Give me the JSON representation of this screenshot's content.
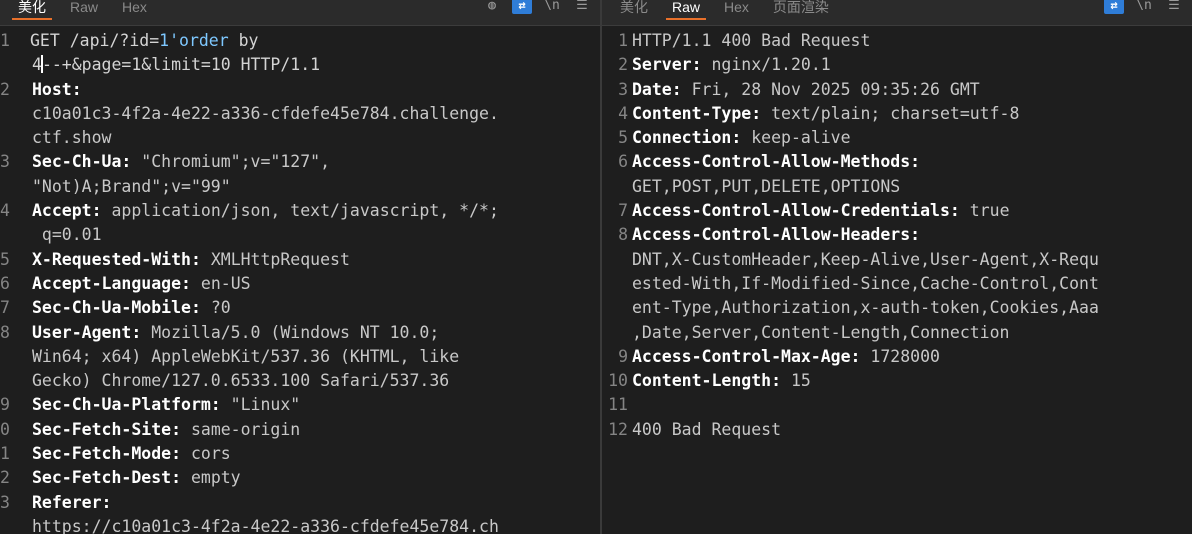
{
  "request": {
    "tabs": [
      {
        "label": "美化",
        "active": true
      },
      {
        "label": "Raw",
        "active": false
      },
      {
        "label": "Hex",
        "active": false
      }
    ],
    "lines": [
      {
        "num": "1",
        "a": "GET /api/?id=",
        "b": "1'order",
        "c": " by"
      },
      {
        "num": "",
        "a": "4",
        "b": "--+&page=1&limit=10 HTTP/1.1"
      },
      {
        "num": "2",
        "k": "Host:",
        "v": ""
      },
      {
        "num": "",
        "v": "c10a01c3-4f2a-4e22-a336-cfdefe45e784.challenge."
      },
      {
        "num": "",
        "v": "ctf.show"
      },
      {
        "num": "3",
        "k": "Sec-Ch-Ua:",
        "v": " \"Chromium\";v=\"127\","
      },
      {
        "num": "",
        "v": "\"Not)A;Brand\";v=\"99\""
      },
      {
        "num": "4",
        "k": "Accept:",
        "v": " application/json, text/javascript, */*;"
      },
      {
        "num": "",
        "v": " q=0.01"
      },
      {
        "num": "5",
        "k": "X-Requested-With:",
        "v": " XMLHttpRequest"
      },
      {
        "num": "6",
        "k": "Accept-Language:",
        "v": " en-US"
      },
      {
        "num": "7",
        "k": "Sec-Ch-Ua-Mobile:",
        "v": " ?0"
      },
      {
        "num": "8",
        "k": "User-Agent:",
        "v": " Mozilla/5.0 (Windows NT 10.0;"
      },
      {
        "num": "",
        "v": "Win64; x64) AppleWebKit/537.36 (KHTML, like"
      },
      {
        "num": "",
        "v": "Gecko) Chrome/127.0.6533.100 Safari/537.36"
      },
      {
        "num": "9",
        "k": "Sec-Ch-Ua-Platform:",
        "v": " \"Linux\""
      },
      {
        "num": "0",
        "k": "Sec-Fetch-Site:",
        "v": " same-origin"
      },
      {
        "num": "1",
        "k": "Sec-Fetch-Mode:",
        "v": " cors"
      },
      {
        "num": "2",
        "k": "Sec-Fetch-Dest:",
        "v": " empty"
      },
      {
        "num": "3",
        "k": "Referer:",
        "v": ""
      },
      {
        "num": "",
        "v": "https://c10a01c3-4f2a-4e22-a336-cfdefe45e784.ch"
      }
    ]
  },
  "response": {
    "tabs": [
      {
        "label": "美化",
        "active": false
      },
      {
        "label": "Raw",
        "active": true
      },
      {
        "label": "Hex",
        "active": false
      },
      {
        "label": "页面渲染",
        "active": false
      }
    ],
    "lines": [
      {
        "num": "1",
        "v": "HTTP/1.1 400 Bad Request"
      },
      {
        "num": "2",
        "k": "Server:",
        "v": " nginx/1.20.1"
      },
      {
        "num": "3",
        "k": "Date:",
        "v": " Fri, 28 Nov 2025 09:35:26 GMT"
      },
      {
        "num": "4",
        "k": "Content-Type:",
        "v": " text/plain; charset=utf-8"
      },
      {
        "num": "5",
        "k": "Connection:",
        "v": " keep-alive"
      },
      {
        "num": "6",
        "k": "Access-Control-Allow-Methods:",
        "v": ""
      },
      {
        "num": "",
        "v": "GET,POST,PUT,DELETE,OPTIONS"
      },
      {
        "num": "7",
        "k": "Access-Control-Allow-Credentials:",
        "v": " true"
      },
      {
        "num": "8",
        "k": "Access-Control-Allow-Headers:",
        "v": ""
      },
      {
        "num": "",
        "v": "DNT,X-CustomHeader,Keep-Alive,User-Agent,X-Requ"
      },
      {
        "num": "",
        "v": "ested-With,If-Modified-Since,Cache-Control,Cont"
      },
      {
        "num": "",
        "v": "ent-Type,Authorization,x-auth-token,Cookies,Aaa"
      },
      {
        "num": "",
        "v": ",Date,Server,Content-Length,Connection"
      },
      {
        "num": "9",
        "k": "Access-Control-Max-Age:",
        "v": " 1728000"
      },
      {
        "num": "10",
        "k": "Content-Length:",
        "v": " 15"
      },
      {
        "num": "11",
        "v": ""
      },
      {
        "num": "12",
        "v": "400 Bad Request"
      }
    ]
  }
}
